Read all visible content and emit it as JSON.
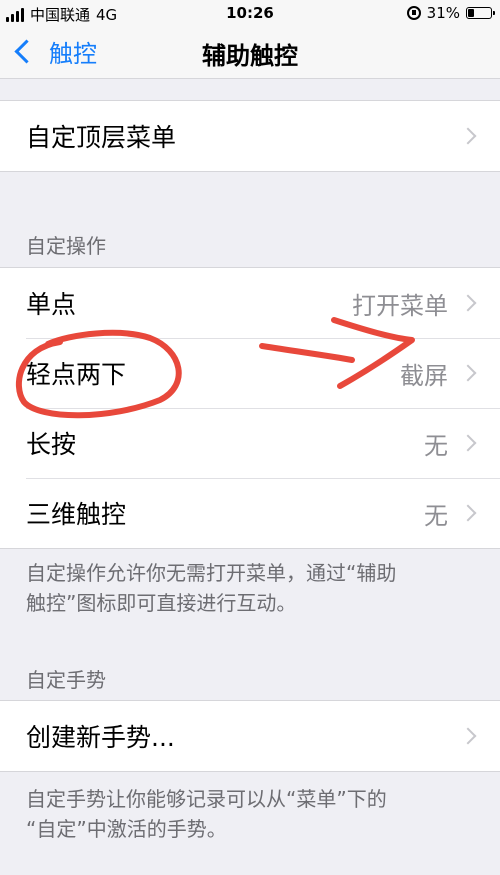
{
  "status_bar": {
    "carrier": "中国联通",
    "network": "4G",
    "time": "10:26",
    "battery": "31%",
    "battery_level": 0.31
  },
  "nav": {
    "back_label": "触控",
    "title": "辅助触控"
  },
  "top_menu": {
    "label": "自定顶层菜单"
  },
  "custom_actions": {
    "header": "自定操作",
    "items": [
      {
        "label": "单点",
        "value": "打开菜单"
      },
      {
        "label": "轻点两下",
        "value": "截屏"
      },
      {
        "label": "长按",
        "value": "无"
      },
      {
        "label": "三维触控",
        "value": "无"
      }
    ],
    "footer_line1": "自定操作允许你无需打开菜单，通过“辅助",
    "footer_line2": "触控”图标即可直接进行互动。"
  },
  "custom_gestures": {
    "header": "自定手势",
    "create_label": "创建新手势...",
    "footer_line1": "自定手势让你能够记录可以从“菜单”下的",
    "footer_line2": "“自定”中激活的手势。"
  },
  "colors": {
    "accent": "#157efb",
    "annotation": "#e8483b",
    "background": "#efeff4"
  }
}
